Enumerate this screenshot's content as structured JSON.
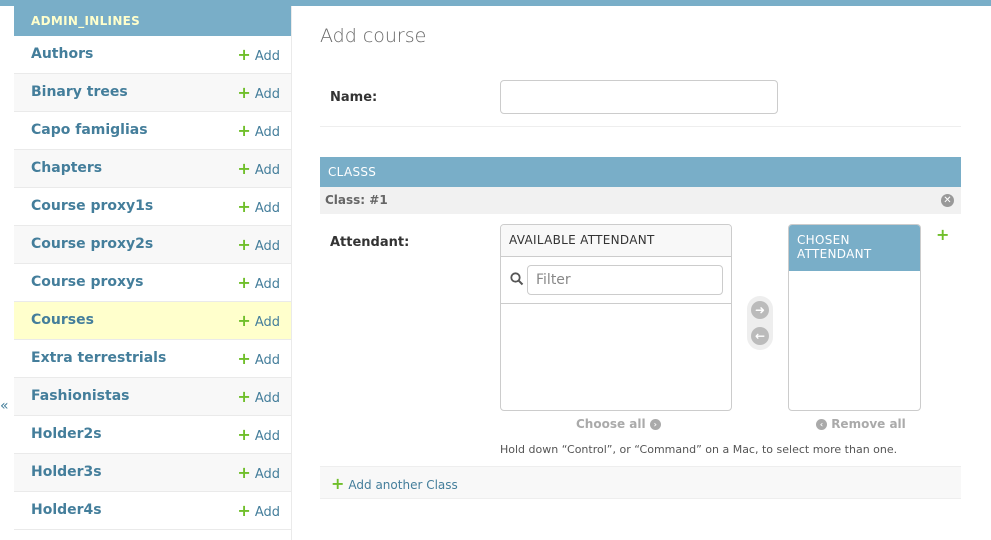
{
  "app": {
    "section": "ADMIN_INLINES"
  },
  "sidebar": {
    "items": [
      {
        "label": "Authors",
        "add": "Add"
      },
      {
        "label": "Binary trees",
        "add": "Add"
      },
      {
        "label": "Capo famiglias",
        "add": "Add"
      },
      {
        "label": "Chapters",
        "add": "Add"
      },
      {
        "label": "Course proxy1s",
        "add": "Add"
      },
      {
        "label": "Course proxy2s",
        "add": "Add"
      },
      {
        "label": "Course proxys",
        "add": "Add"
      },
      {
        "label": "Courses",
        "add": "Add"
      },
      {
        "label": "Extra terrestrials",
        "add": "Add"
      },
      {
        "label": "Fashionistas",
        "add": "Add"
      },
      {
        "label": "Holder2s",
        "add": "Add"
      },
      {
        "label": "Holder3s",
        "add": "Add"
      },
      {
        "label": "Holder4s",
        "add": "Add"
      }
    ],
    "collapse_glyph": "«"
  },
  "main": {
    "title": "Add course",
    "name_label": "Name:",
    "name_value": "",
    "inline": {
      "header": "CLASSS",
      "item_label": "Class: #1",
      "attendant_label": "Attendant:",
      "available_title": "AVAILABLE ATTENDANT",
      "filter_placeholder": "Filter",
      "chosen_title": "CHOSEN ATTENDANT",
      "choose_all": "Choose all",
      "remove_all": "Remove all",
      "help_text": "Hold down “Control”, or “Command” on a Mac, to select more than one.",
      "add_another": "Add another Class"
    }
  },
  "colors": {
    "primary": "#79aec8",
    "link": "#447e9b",
    "add_green": "#70bf2b",
    "highlight": "#ffffcc"
  }
}
